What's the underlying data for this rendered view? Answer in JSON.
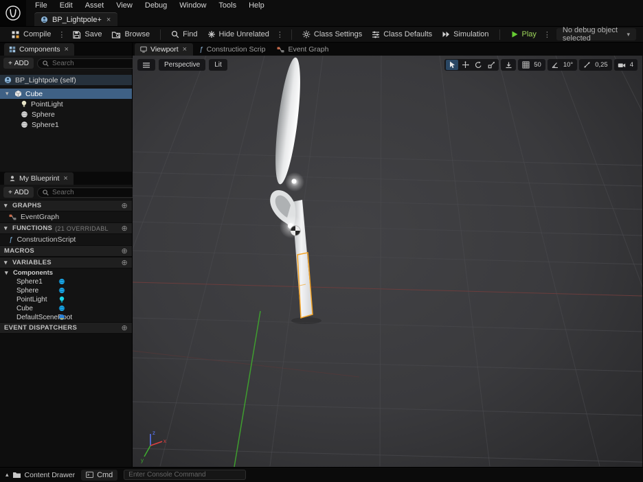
{
  "glyphs": {
    "kebab": "⋮",
    "close": "×",
    "chevron_down": "▾",
    "caret": "▾",
    "chevron_up": "▴",
    "plus": "+",
    "plus_circle": "⊕",
    "fn": "ƒ",
    "x_axis": "x",
    "y_axis": "y",
    "z_axis": "z"
  },
  "colors": {
    "selection_blue": "#3f6185",
    "selection_orange": "#f3a326",
    "play_green": "#66cc33",
    "component_icon_blue": "#1aa7e8"
  },
  "menubar": {
    "items": [
      "File",
      "Edit",
      "Asset",
      "View",
      "Debug",
      "Window",
      "Tools",
      "Help"
    ]
  },
  "asset_tab": {
    "title": "BP_Lightpole+"
  },
  "toolbar": {
    "compile": "Compile",
    "save": "Save",
    "browse": "Browse",
    "find": "Find",
    "hide_unrelated": "Hide Unrelated",
    "class_settings": "Class Settings",
    "class_defaults": "Class Defaults",
    "simulation": "Simulation",
    "play": "Play",
    "debug_object": "No debug object selected"
  },
  "components": {
    "tab": "Components",
    "add": "ADD",
    "search_placeholder": "Search",
    "rows": [
      {
        "label": "BP_Lightpole (self)",
        "icon": "blueprint-actor-icon"
      },
      {
        "label": "Cube",
        "icon": "cube-icon"
      },
      {
        "label": "PointLight",
        "icon": "point-light-icon"
      },
      {
        "label": "Sphere",
        "icon": "sphere-icon"
      },
      {
        "label": "Sphere1",
        "icon": "sphere-icon"
      }
    ]
  },
  "my_blueprint": {
    "tab": "My Blueprint",
    "add": "ADD",
    "search_placeholder": "Search",
    "graphs_header": "GRAPHS",
    "graphs_items": [
      "EventGraph"
    ],
    "functions_header": "FUNCTIONS",
    "functions_badge": "(21 OVERRIDABL",
    "functions_items": [
      "ConstructionScript"
    ],
    "macros_header": "MACROS",
    "variables_header": "VARIABLES",
    "variables_category": "Components",
    "variables": [
      {
        "name": "Sphere1",
        "icon": "sphere-variable-icon"
      },
      {
        "name": "Sphere",
        "icon": "sphere-variable-icon"
      },
      {
        "name": "PointLight",
        "icon": "light-variable-icon"
      },
      {
        "name": "Cube",
        "icon": "object-variable-icon"
      },
      {
        "name": "DefaultSceneRoot",
        "icon": "scene-root-variable-icon"
      }
    ],
    "event_dispatchers_header": "EVENT DISPATCHERS"
  },
  "viewport": {
    "tab_viewport": "Viewport",
    "tab_construction": "Construction Scrip",
    "tab_event_graph": "Event Graph",
    "perspective": "Perspective",
    "lit": "Lit",
    "grid_snap": "50",
    "angle_snap": "10°",
    "scale_snap": "0,25",
    "camera_speed": "4"
  },
  "status_bar": {
    "content_drawer": "Content Drawer",
    "cmd": "Cmd",
    "console_placeholder": "Enter Console Command"
  }
}
